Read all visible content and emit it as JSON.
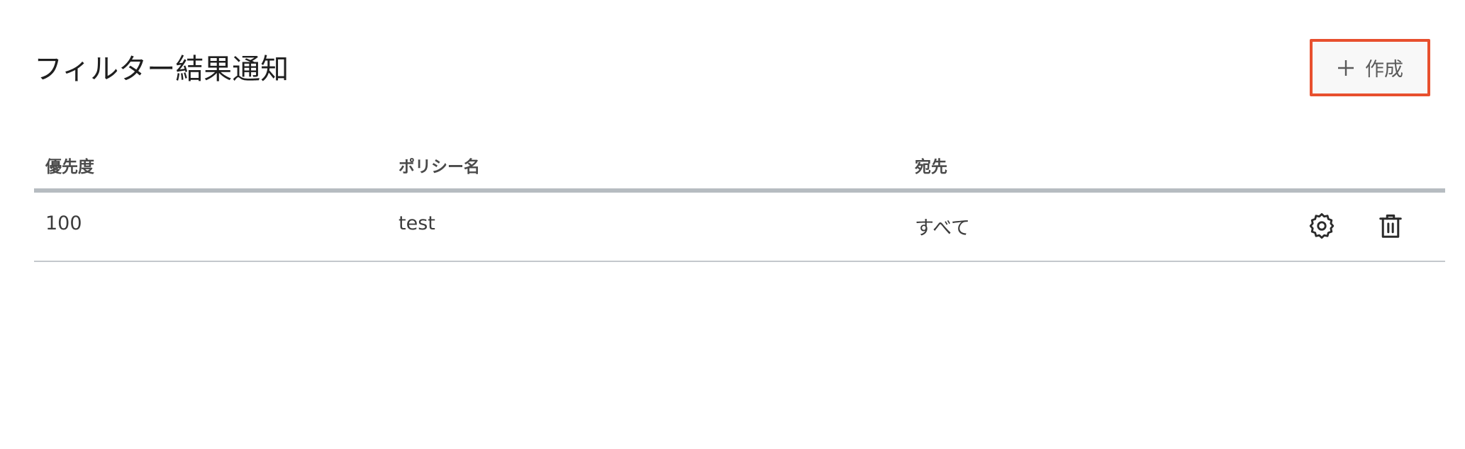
{
  "header": {
    "title": "フィルター結果通知",
    "create_label": "作成"
  },
  "table": {
    "columns": {
      "priority": "優先度",
      "policy_name": "ポリシー名",
      "destination": "宛先"
    },
    "rows": [
      {
        "priority": "100",
        "policy_name": "test",
        "destination": "すべて"
      }
    ]
  },
  "icons": {
    "create": "plus-icon",
    "settings": "gear-icon",
    "delete": "trash-icon"
  },
  "colors": {
    "create_button_border": "#e8502e",
    "header_divider": "#b6bcc1"
  }
}
